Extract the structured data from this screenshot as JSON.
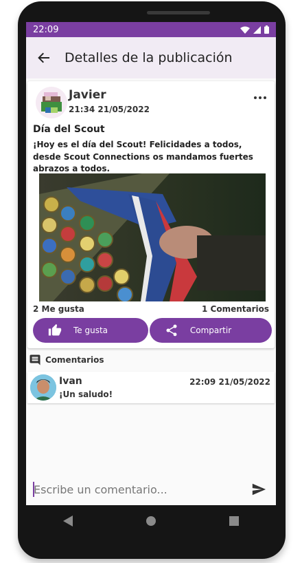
{
  "status_bar": {
    "time": "22:09"
  },
  "app_bar": {
    "title": "Detalles de la publicación"
  },
  "post": {
    "author": "Javier",
    "date": "21:34 21/05/2022",
    "title": "Día del Scout",
    "body": "¡Hoy es el día del Scout! Felicidades a todos, desde Scout Connections os mandamos fuertes abrazos a todos.",
    "likes": "2 Me gusta",
    "comments_count": "1 Comentarios",
    "like_button": "Te gusta",
    "share_button": "Compartir"
  },
  "comments_section": {
    "header": "Comentarios",
    "items": [
      {
        "author": "Ivan",
        "time": "22:09 21/05/2022",
        "text": "¡Un saludo!"
      }
    ]
  },
  "comment_input": {
    "placeholder": "Escribe un comentario..."
  },
  "colors": {
    "accent": "#7a3ea1",
    "app_bar_bg": "#f1ebf4"
  },
  "icons": [
    "back-arrow-icon",
    "more-vert-icon",
    "thumb-up-icon",
    "share-icon",
    "comment-icon",
    "send-icon",
    "nav-back-icon",
    "nav-home-icon",
    "nav-recents-icon"
  ]
}
